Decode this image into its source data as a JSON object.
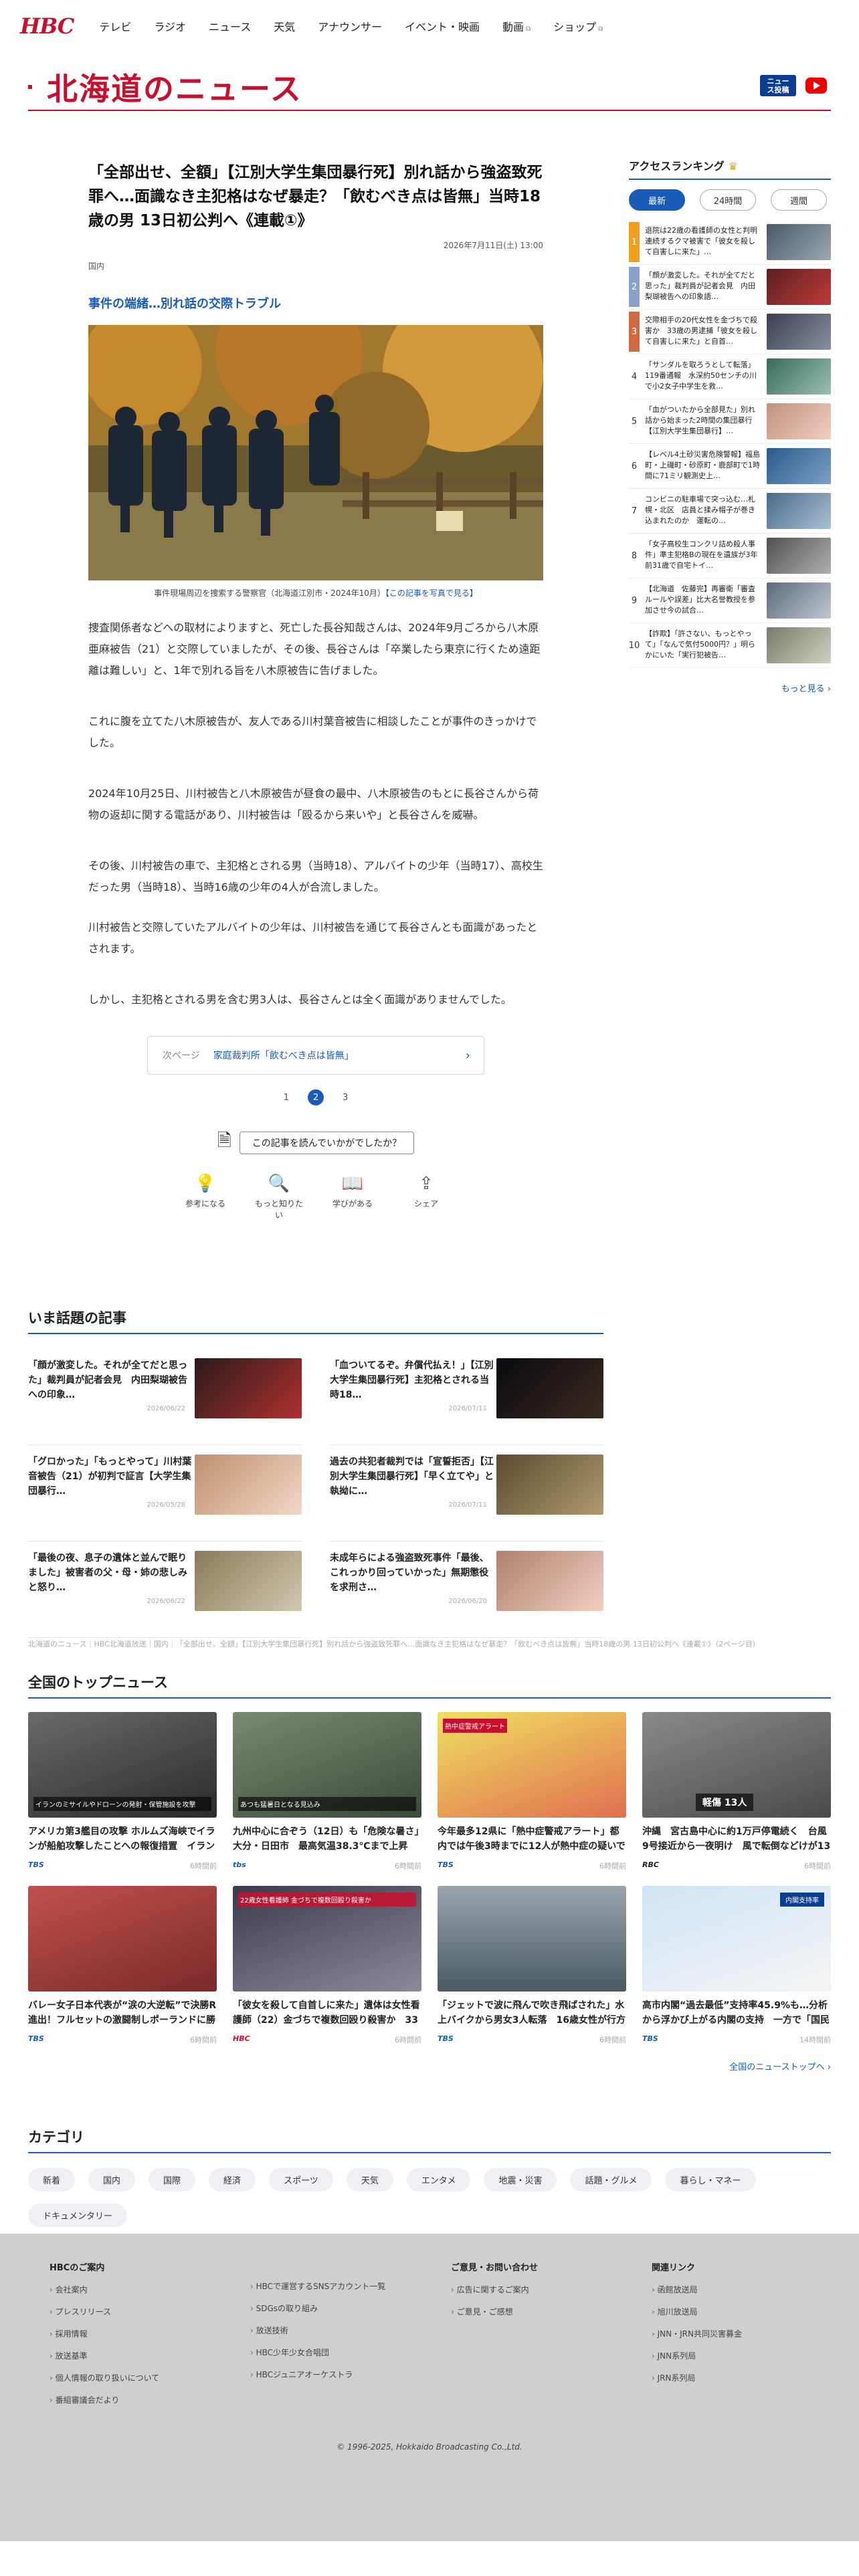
{
  "nav": {
    "logo": "HBC",
    "items": [
      "テレビ",
      "ラジオ",
      "ニュース",
      "天気",
      "アナウンサー",
      "イベント・映画",
      "動画",
      "ショップ"
    ],
    "ext_mark": "⧉"
  },
  "brand": {
    "title": "北海道のニュース",
    "news_post": "ニュース投稿"
  },
  "article": {
    "title": "「全部出せ、全額」【江別大学生集団暴行死】別れ話から強盗致死罪へ…面識なき主犯格はなぜ暴走？「飲むべき点は皆無」当時18歳の男 13日初公判へ《連載①》",
    "date": "2026年7月11日(土) 13:00",
    "category": "国内",
    "subtitle": "事件の端緒…別れ話の交際トラブル",
    "caption": "事件現場周辺を捜索する警察官（北海道江別市・2024年10月）",
    "caption_link": "【この記事を写真で見る】",
    "paragraphs": [
      "捜査関係者などへの取材によりますと、死亡した長谷知哉さんは、2024年9月ごろから八木原亜麻被告（21）と交際していましたが、その後、長谷さんは「卒業したら東京に行くため遠距離は難しい」と、1年で別れる旨を八木原被告に告げました。",
      "これに腹を立てた八木原被告が、友人である川村葉音被告に相談したことが事件のきっかけでした。",
      "2024年10月25日、川村被告と八木原被告が昼食の最中、八木原被告のもとに長谷さんから荷物の返却に関する電話があり、川村被告は「殴るから来いや」と長谷さんを威嚇。",
      "その後、川村被告の車で、主犯格とされる男（当時18）、アルバイトの少年（当時17）、高校生だった男（当時18）、当時16歳の少年の4人が合流しました。",
      "川村被告と交際していたアルバイトの少年は、川村被告を通じて長谷さんとも面識があったとされます。",
      "しかし、主犯格とされる男を含む男3人は、長谷さんとは全く面識がありませんでした。"
    ],
    "next_label": "次ページ",
    "next_title": "家庭裁判所「飲むべき点は皆無」",
    "pages": [
      "1",
      "2",
      "3"
    ],
    "feedback_q": "この記事を読んでいかがでしたか？",
    "feedback": [
      {
        "icon": "💡",
        "label": "参考になる"
      },
      {
        "icon": "🔍",
        "label": "もっと知りたい"
      },
      {
        "icon": "📖",
        "label": "学びがある"
      },
      {
        "icon": "⇪",
        "label": "シェア"
      }
    ]
  },
  "ranking": {
    "title": "アクセスランキング",
    "tabs": [
      "最新",
      "24時間",
      "週間"
    ],
    "items": [
      {
        "n": "1",
        "text": "退院は22歳の看護師の女性と判明　連続するクマ被害で「彼女を殺して自害しに来た」…"
      },
      {
        "n": "2",
        "text": "「顔が激変した。それが全てだと思った」裁判員が記者会見　内田梨瑚被告への印象語…"
      },
      {
        "n": "3",
        "text": "交際相手の20代女性を金づちで殺害か　33歳の男逮捕「彼女を殺して自害しに来た」と自首…"
      },
      {
        "n": "4",
        "text": "「サンダルを取ろうとして転落」119番通報　水深約50センチの川で小2女子中学生を救…"
      },
      {
        "n": "5",
        "text": "「血がついたから全部見た」別れ話から始まった2時間の集団暴行【江別大学生集団暴行】…"
      },
      {
        "n": "6",
        "text": "【レベル4土砂災害危険警報】福島町・上磯町・砂原町・鹿部町で1時間に71ミリ観測史上…"
      },
      {
        "n": "7",
        "text": "コンビニの駐車場で突っ込む…札幌・北区　店員と揉み帽子が巻き込まれたのか　運転の…"
      },
      {
        "n": "8",
        "text": "「女子高校生コンクリ詰め殺人事件」準主犯格Bの現在を遺族が3年前31歳で自宅トイ…"
      },
      {
        "n": "9",
        "text": "【北海道　佐藤完】再審衛「審査ルールや誤差」比大名誉教授を参加させ今の試合…"
      },
      {
        "n": "10",
        "text": "【詐欺】「許さない、もっとやって」「なんで気付5000円？」明らかにいた「実行犯被告…"
      }
    ],
    "more": "もっと見る"
  },
  "topics": {
    "title": "いま話題の記事",
    "items": [
      {
        "title": "「顔が激変した。それが全てだと思った」裁判員が記者会見　内田梨瑚被告への印象…",
        "date": "2026/06/22"
      },
      {
        "title": "「血ついてるぞ。弁償代払え！」【江別大学生集団暴行死】主犯格とされる当時18…",
        "date": "2026/07/11"
      },
      {
        "title": "「グロかった」「もっとやって」川村葉音被告（21）が初判で証言【大学生集団暴行…",
        "date": "2026/05/28"
      },
      {
        "title": "過去の共犯者裁判では「宣誓拒否」【江別大学生集団暴行死】「早く立てや」と執拗に…",
        "date": "2026/07/11"
      },
      {
        "title": "「最後の夜、息子の遺体と並んで眠りました」被害者の父・母・姉の悲しみと怒り…",
        "date": "2026/06/22"
      },
      {
        "title": "未成年らによる強盗致死事件「最後、これっかり回っていかった」無期懲役を求刑さ…",
        "date": "2026/06/20"
      }
    ]
  },
  "breadcrumb": "北海道のニュース｜HBC北海道放送｜国内｜「全部出せ、全額」【江別大学生集団暴行死】別れ話から強盗致死罪へ…面識なき主犯格はなぜ暴走？「飲むべき点は皆無」当時18歳の男 13日初公判へ《連載①》（2ページ目）",
  "national": {
    "title": "全国のトップニュース",
    "items": [
      {
        "title": "アメリカ第3艦目の攻撃 ホルムズ海峡でイランが船舶攻撃したことへの報復措置　イランは米軍基地にミサイル…",
        "src": "TBS",
        "ago": "6時間前",
        "badge": "イランのミサイルやドローンの発射・保管施設を攻撃"
      },
      {
        "title": "九州中心に合ぞう（12日）も「危険な暑さ」大分・日田市　最高気温38.3℃まで上昇「鋼生金山」ではひとき…",
        "src": "tbs",
        "ago": "6時間前",
        "badge": "あつも猛暑日となる見込み"
      },
      {
        "title": "今年最多12県に「熱中症警戒アラート」都内では午後3時までに12人が熱中症の疑いで救急搬送　あす（13日…",
        "src": "TBS",
        "ago": "6時間前",
        "badge": "熱中症警戒アラート"
      },
      {
        "title": "沖縄　宮古島中心に約1万戸停電続く　台風9号接近から一夜明け　風で転倒などけが13人が　被害確認中",
        "src": "RBC",
        "ago": "6時間前",
        "badge": "軽傷 13人"
      },
      {
        "title": "バレー女子日本代表が“涙の大逆転”で決勝R進出！フルセットの激闘制しポーランドに勝利【ネーションズリーグ】",
        "src": "TBS",
        "ago": "6時間前",
        "badge": ""
      },
      {
        "title": "「彼女を殺して自首しに来た」遺体は女性看護師（22）金づちで複数回殴り殺害か　33歳男逮捕　2人は交際…",
        "src": "HBC",
        "ago": "6時間前",
        "badge": "22歳女性看護師 金づちで複数回殴り殺害か"
      },
      {
        "title": "「ジェットで波に飛んで吹き飛ばされた」水上バイクから男女3人転落　16歳女性が行方不明　男性2人は40歳1…",
        "src": "TBS",
        "ago": "6時間前",
        "badge": ""
      },
      {
        "title": "高市内閣“過去最低”支持率45.9%も…分析から浮かび上がる内閣の支持　一方で「国民の総意」との乖離広げた…",
        "src": "TBS",
        "ago": "14時間前",
        "badge": "内閣支持率"
      }
    ],
    "more": "全国のニューストップへ"
  },
  "categories": {
    "title": "カテゴリ",
    "items": [
      "新着",
      "国内",
      "国際",
      "経済",
      "スポーツ",
      "天気",
      "エンタメ",
      "地震・災害",
      "話題・グルメ",
      "暮らし・マネー",
      "ドキュメンタリー"
    ]
  },
  "footer": {
    "cols": [
      {
        "h": "HBCのご案内",
        "items": [
          "会社案内",
          "プレスリリース",
          "採用情報",
          "放送基準",
          "個人情報の取り扱いについて",
          "番組審議会だより"
        ]
      },
      {
        "h": "",
        "items": [
          "HBCで運営するSNSアカウント一覧",
          "SDGsの取り組み",
          "放送技術",
          "HBC少年少女合唱団",
          "HBCジュニアオーケストラ"
        ]
      },
      {
        "h": "ご意見・お問い合わせ",
        "items": [
          "広告に関するご案内",
          "ご意見・ご感想"
        ]
      },
      {
        "h": "関連リンク",
        "items": [
          "函館放送局",
          "旭川放送局",
          "JNN・JRN共同災害募金",
          "JNN系列局",
          "JRN系列局"
        ]
      }
    ],
    "copyright": "© 1996-2025, Hokkaido Broadcasting Co.,Ltd."
  },
  "colors": {
    "brand_red": "#c8102e",
    "link_blue": "#1a5bb8",
    "rank1": "#f0a020",
    "rank2": "#8aa0c8",
    "rank3": "#d06a40"
  }
}
